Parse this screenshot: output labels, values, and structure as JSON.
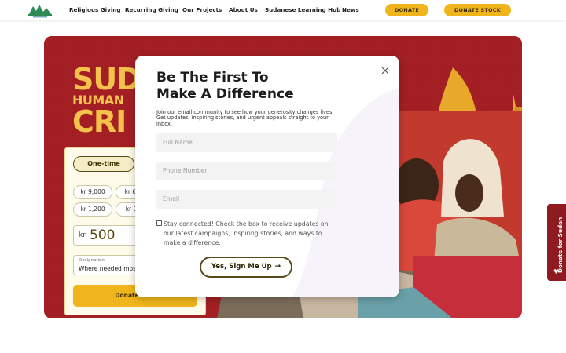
{
  "nav": {
    "items": [
      "Religious Giving",
      "Recurring Giving",
      "Our Projects",
      "About Us",
      "Sudanese Learning Hub",
      "News"
    ],
    "donate_label": "DONATE",
    "donate_stock_label": "DONATE STOCK"
  },
  "hero": {
    "title_line1": "SUD",
    "title_line2": "HUMAN",
    "title_line3": "CRI"
  },
  "widget": {
    "frequency_selected": "One-time",
    "amounts": [
      "kr 9,000",
      "kr 6,",
      "kr 1,200",
      "kr 9"
    ],
    "currency": "kr",
    "amount_value": "500",
    "designation_label": "Designation",
    "designation_value": "Where needed most",
    "donate_now_label": "Donate Now"
  },
  "modal": {
    "title_line1": "Be The First To",
    "title_line2": "Make A Difference",
    "description": "Join our email community to see how your generosity changes lives. Get updates, inspiring stories, and urgent appeals straight to your inbox.",
    "full_name_placeholder": "Full Name",
    "phone_placeholder": "Phone Number",
    "email_placeholder": "Email",
    "checkbox_label": "Stay connected! Check the box to receive updates on our latest campaigns, inspiring stories, and ways to make a difference.",
    "submit_label": "Yes, Sign Me Up",
    "close_icon": "close-icon",
    "arrow_icon": "arrow-right-icon"
  },
  "side_tab": {
    "label": "Donate for Sudan",
    "icon": "heart-icon"
  },
  "colors": {
    "accent": "#f0b51c",
    "hero_red": "#a31f24",
    "side_tab": "#8e1b1f"
  }
}
